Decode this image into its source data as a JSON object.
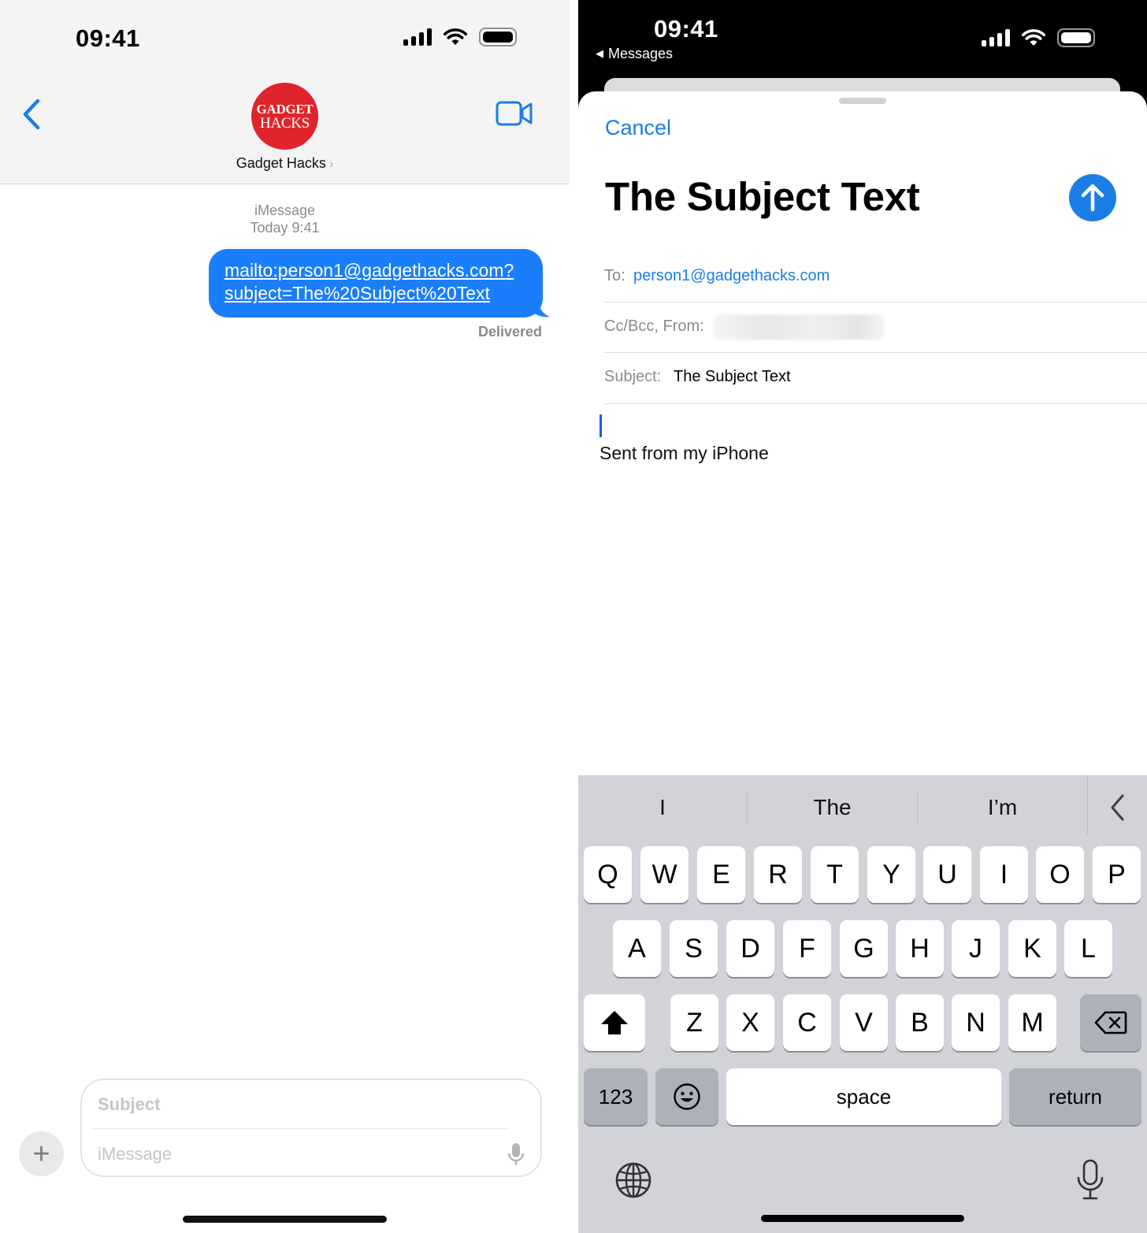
{
  "left": {
    "status_bar": {
      "time": "09:41"
    },
    "contact": {
      "name": "Gadget Hacks",
      "avatar_line1": "GADGET",
      "avatar_line2": "HACKS"
    },
    "conversation": {
      "service": "iMessage",
      "timestamp": "Today 9:41",
      "message_line1": "mailto:person1@gadgethacks.com?",
      "message_line2": "subject=The%20Subject%20Text",
      "status": "Delivered"
    },
    "composer": {
      "plus_label": "+",
      "subject_placeholder": "Subject",
      "message_placeholder": "iMessage"
    },
    "icons": [
      "chevron-left-icon",
      "video-camera-icon",
      "plus-icon",
      "microphone-icon",
      "cellular-signal-icon",
      "wifi-icon",
      "battery-icon"
    ]
  },
  "right": {
    "status_bar": {
      "time": "09:41",
      "back_app": "Messages"
    },
    "mail": {
      "cancel": "Cancel",
      "title": "The Subject Text",
      "to_label": "To:",
      "to_value": "person1@gadgethacks.com",
      "cc_label": "Cc/Bcc, From:",
      "subject_label": "Subject:",
      "subject_value": "The Subject Text",
      "signature": "Sent from my iPhone"
    },
    "keyboard": {
      "suggestions": [
        "I",
        "The",
        "I’m"
      ],
      "row1": [
        "Q",
        "W",
        "E",
        "R",
        "T",
        "Y",
        "U",
        "I",
        "O",
        "P"
      ],
      "row2": [
        "A",
        "S",
        "D",
        "F",
        "G",
        "H",
        "J",
        "K",
        "L"
      ],
      "row3": [
        "Z",
        "X",
        "C",
        "V",
        "B",
        "N",
        "M"
      ],
      "numbers": "123",
      "space": "space",
      "return": "return"
    },
    "icons": [
      "arrow-up-icon",
      "chevron-left-icon",
      "shift-icon",
      "delete-icon",
      "emoji-icon",
      "globe-icon",
      "microphone-icon"
    ]
  },
  "colors": {
    "ios_blue": "#1a7ee6",
    "bubble_blue": "#1a7efb",
    "avatar_red": "#e0242b",
    "keyboard_bg": "#d1d3d9"
  }
}
